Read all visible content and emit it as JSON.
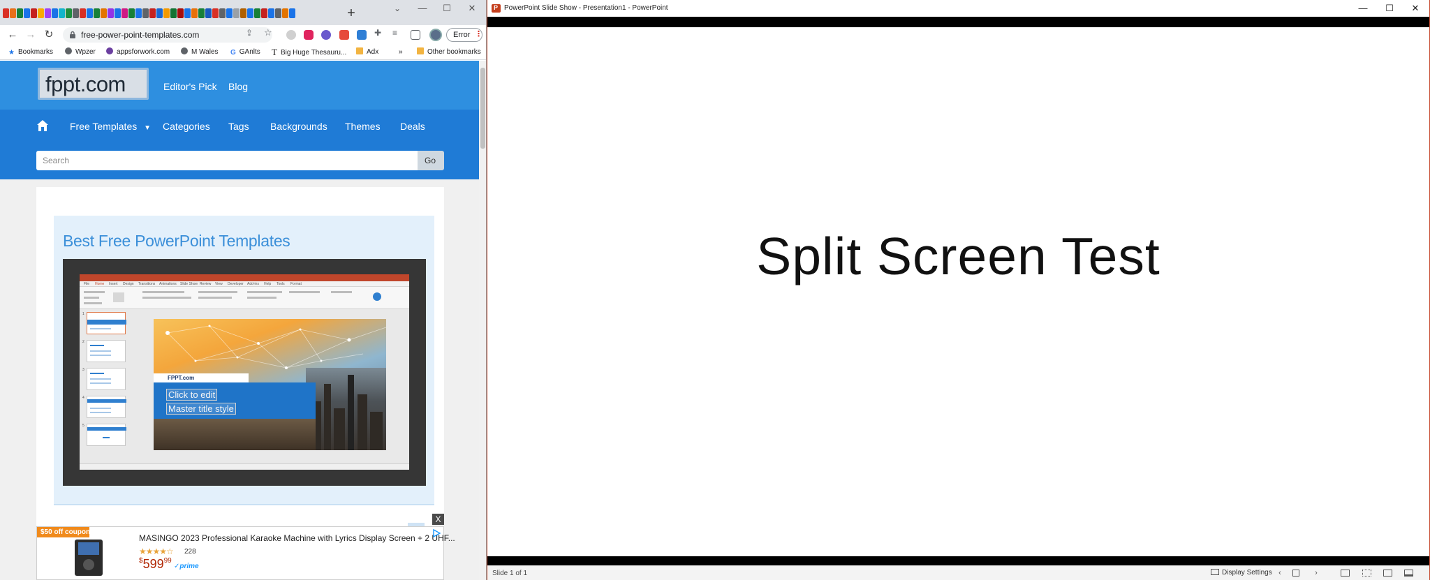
{
  "browser": {
    "tab_colors": [
      "#d93025",
      "#e8711a",
      "#188038",
      "#1a73e8",
      "#c5221f",
      "#f9ab00",
      "#a142f4",
      "#1a73e8",
      "#12b5cb",
      "#1e8e3e",
      "#5f6368",
      "#d93025",
      "#1a73e8",
      "#188038",
      "#e37400",
      "#9334e6",
      "#1a73e8",
      "#d01884",
      "#188038",
      "#1a73e8",
      "#5f6368",
      "#c5221f",
      "#1967d2",
      "#f29900",
      "#137333",
      "#a50e0e",
      "#1a73e8",
      "#e8710a",
      "#188038",
      "#185abc",
      "#d93025",
      "#5f6368",
      "#1a73e8",
      "#9aa0a6",
      "#b06000",
      "#1a73e8",
      "#188038",
      "#c5221f",
      "#1a73e8",
      "#5f6368",
      "#e37400",
      "#1a73e8"
    ],
    "new_tab_label": "+",
    "url": "free-power-point-templates.com",
    "error_label": "Error",
    "bookmarks": [
      {
        "label": "Bookmarks",
        "icon": "star-icon",
        "color": "#1a73e8"
      },
      {
        "label": "Wpzer",
        "icon": "globe-icon",
        "color": "#5f6368"
      },
      {
        "label": "appsforwork.com",
        "icon": "site-icon",
        "color": "#6b3fa0"
      },
      {
        "label": "M Wales",
        "icon": "globe-icon",
        "color": "#5f6368"
      },
      {
        "label": "GAnlts",
        "icon": "google-icon",
        "color": "#4285f4"
      },
      {
        "label": "Big Huge Thesauru...",
        "icon": "t-icon",
        "color": "#222222"
      },
      {
        "label": "Adx",
        "icon": "folder-icon",
        "color": "#f2b441"
      }
    ],
    "more_bookmarks": "»",
    "other_bookmarks": "Other bookmarks"
  },
  "site": {
    "logo_text": "fppt.com",
    "top_links": [
      "Editor's Pick",
      "Blog"
    ],
    "nav": [
      "Free Templates",
      "Categories",
      "Tags",
      "Backgrounds",
      "Themes",
      "Deals"
    ],
    "search_placeholder": "Search",
    "search_button": "Go",
    "panel_title": "Best Free PowerPoint Templates",
    "screenshot": {
      "brand": "FPPT.com",
      "placeholder_line1": "Click to edit",
      "placeholder_line2": "Master title style",
      "menu_items": [
        "File",
        "Home",
        "Insert",
        "Design",
        "Transitions",
        "Animations",
        "Slide Show",
        "Review",
        "View",
        "Developer",
        "Add-ins",
        "Help",
        "Tools",
        "Format"
      ]
    },
    "ad": {
      "coupon": "$50 off coupon",
      "title": "MASINGO 2023 Professional Karaoke Machine with Lyrics Display Screen + 2 UHF...",
      "stars": "★★★★☆",
      "rating": 4.5,
      "review_count": "228",
      "price_currency": "$",
      "price_whole": "599",
      "price_cents": "99",
      "prime": "✓prime",
      "close": "X"
    }
  },
  "powerpoint": {
    "window_title": "PowerPoint Slide Show  -  Presentation1 - PowerPoint",
    "app_icon_letter": "P",
    "slide_title": "Split Screen Test",
    "status_slide": "Slide 1 of 1",
    "display_settings": "Display Settings"
  }
}
